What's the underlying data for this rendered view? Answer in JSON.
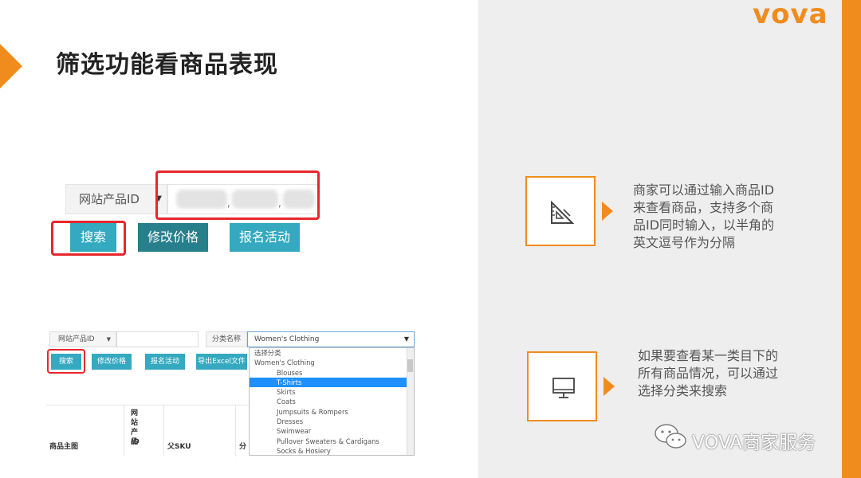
{
  "slide": {
    "title": "筛选功能看商品表现",
    "logo": "vova",
    "watermark": "VOVA商家服务",
    "colors": {
      "accent": "#f08c1e",
      "button": "#34a9c0",
      "button_dark": "#277f8c",
      "highlight": "#e8262d",
      "right_bg": "#eeeeee"
    }
  },
  "demo_top": {
    "site_select": "网站产品ID",
    "buttons": {
      "search": "搜索",
      "edit_price": "修改价格",
      "register": "报名活动"
    }
  },
  "demo_shot": {
    "site_select": "网站产品ID",
    "category_label": "分类名称",
    "category_value": "Women's Clothing",
    "buttons": {
      "search": "搜索",
      "edit_price": "修改价格",
      "register": "报名活动",
      "export": "导出Excel文件"
    },
    "dropdown_items": [
      {
        "label": "选择分类",
        "level": "top",
        "selected": false
      },
      {
        "label": "Women's Clothing",
        "level": "top",
        "selected": false
      },
      {
        "label": "Blouses",
        "level": "sub",
        "selected": false
      },
      {
        "label": "T-Shirts",
        "level": "sub",
        "selected": true
      },
      {
        "label": "Skirts",
        "level": "sub",
        "selected": false
      },
      {
        "label": "Coats",
        "level": "sub",
        "selected": false
      },
      {
        "label": "Jumpsuits & Rompers",
        "level": "sub",
        "selected": false
      },
      {
        "label": "Dresses",
        "level": "sub",
        "selected": false
      },
      {
        "label": "Swimwear",
        "level": "sub",
        "selected": false
      },
      {
        "label": "Pullover Sweaters & Cardigans",
        "level": "sub",
        "selected": false
      },
      {
        "label": "Socks & Hosiery",
        "level": "sub",
        "selected": false
      }
    ],
    "table_headers": {
      "main_image": "商品主图",
      "site_id_line1": "网站产品",
      "site_id_line2": "ID",
      "parent_sku": "父SKU",
      "category_partial": "分"
    }
  },
  "cards": [
    {
      "icon": "ruler-triangle-icon",
      "lines": [
        "商家可以通过输入商品ID",
        "来查看商品，支持多个商",
        "品ID同时输入，以半角的",
        "英文逗号作为分隔"
      ]
    },
    {
      "icon": "monitor-icon",
      "lines": [
        "如果要查看某一类目下的",
        "所有商品情况，可以通过",
        "选择分类来搜索"
      ]
    }
  ]
}
